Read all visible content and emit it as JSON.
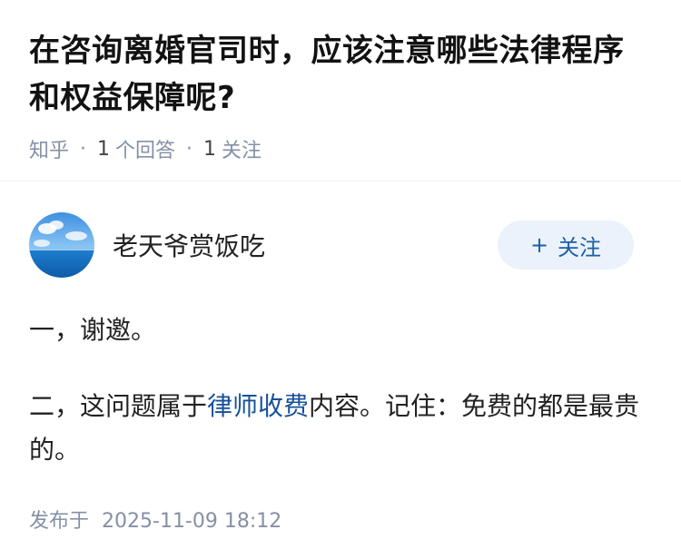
{
  "question": {
    "title": "在咨询离婚官司时，应该注意哪些法律程序和权益保障呢?",
    "source": "知乎",
    "answers_count": "1",
    "answers_label": "个回答",
    "followers_count": "1",
    "followers_label": "关注"
  },
  "answer": {
    "author_name": "老天爷赏饭吃",
    "follow_button": "关注",
    "paragraph1": "一，谢邀。",
    "paragraph2_before": "二，这问题属于",
    "paragraph2_link": "律师收费",
    "paragraph2_after": "内容。记住：免费的都是最贵的。",
    "published_label": "发布于",
    "published_time": "2025-11-09 18:12"
  },
  "colors": {
    "link": "#175199",
    "meta": "#8590a6",
    "follow_bg": "#ebf2fb"
  }
}
